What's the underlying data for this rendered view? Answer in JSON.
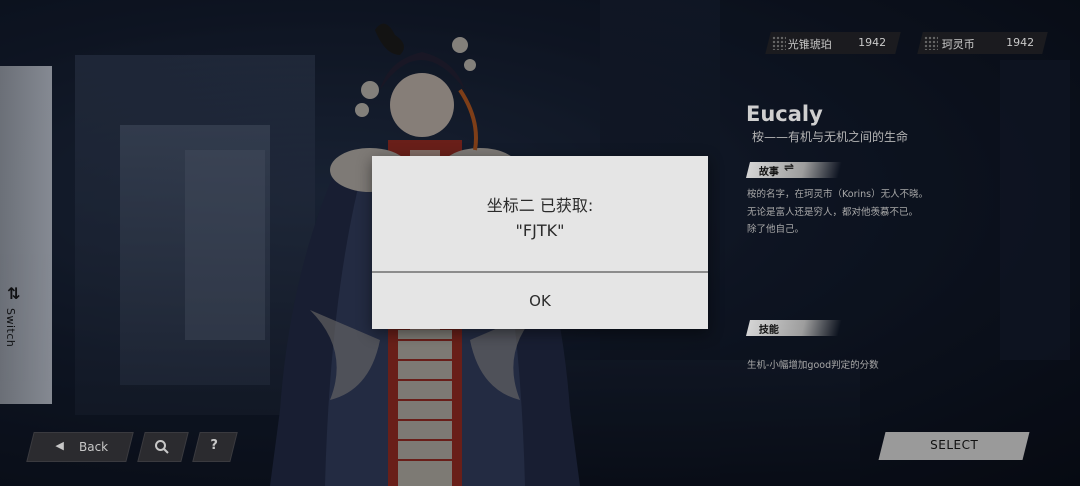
{
  "resources": [
    {
      "label": "光锥琥珀",
      "value": "1942"
    },
    {
      "label": "珂灵币",
      "value": "1942"
    }
  ],
  "side_tab": {
    "label": "Switch",
    "icon": "swap-vertical-icon"
  },
  "character": {
    "name": "Eucaly",
    "subtitle": "桉——有机与无机之间的生命"
  },
  "story": {
    "tag": "故事",
    "icon": "swap-horizontal-icon",
    "lines": [
      "桉的名字，在珂灵市（Korins）无人不晓。",
      "无论是富人还是穷人，都对他羡慕不已。",
      "除了他自己。"
    ]
  },
  "skill": {
    "tag": "技能",
    "description": "生机-小幅增加good判定的分数"
  },
  "nav": {
    "back_label": "Back",
    "back_icon": "triangle-left-icon",
    "search_icon": "search-icon",
    "help_label": "?"
  },
  "select_label": "SELECT",
  "dialog": {
    "line1": "坐标二 已获取:",
    "line2": "\"FJTK\"",
    "ok_label": "OK"
  },
  "colors": {
    "dialog_bg": "#e5e5e5",
    "overlay": "rgba(0,0,0,0.42)",
    "chip_bg": "#1b1b1f",
    "select_bg": "#9a9a9a"
  }
}
